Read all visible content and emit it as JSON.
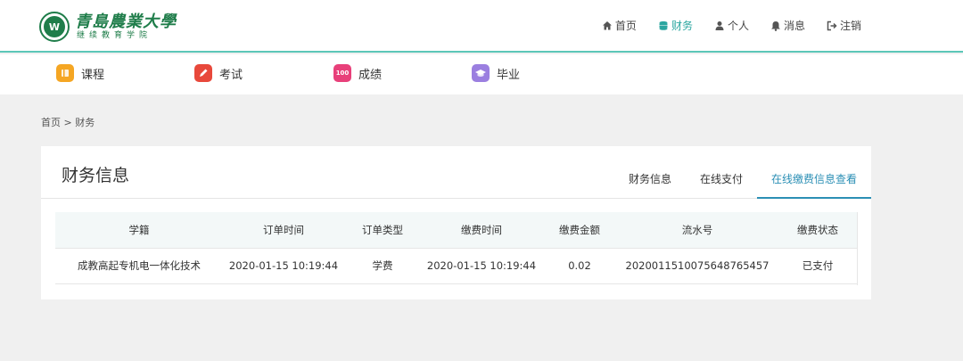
{
  "header": {
    "logo_main": "青島農業大學",
    "logo_sub": "继续教育学院",
    "logo_emblem": "W",
    "nav": [
      {
        "label": "首页",
        "icon": "home-icon"
      },
      {
        "label": "财务",
        "icon": "database-icon"
      },
      {
        "label": "个人",
        "icon": "user-icon"
      },
      {
        "label": "消息",
        "icon": "bell-icon"
      },
      {
        "label": "注销",
        "icon": "logout-icon"
      }
    ]
  },
  "subnav": [
    {
      "label": "课程",
      "icon": "course-icon",
      "color": "#f5a623"
    },
    {
      "label": "考试",
      "icon": "exam-icon",
      "color": "#e8483b"
    },
    {
      "label": "成绩",
      "icon": "score-icon",
      "color": "#e8407a",
      "badge": "100"
    },
    {
      "label": "毕业",
      "icon": "graduation-icon",
      "color": "#9b7fe0"
    }
  ],
  "breadcrumb": {
    "home": "首页",
    "separator": ">",
    "current": "财务"
  },
  "panel": {
    "title": "财务信息",
    "tabs": [
      "财务信息",
      "在线支付",
      "在线缴费信息查看"
    ],
    "active_tab": "在线缴费信息查看"
  },
  "table": {
    "headers": [
      "学籍",
      "订单时间",
      "订单类型",
      "缴费时间",
      "缴费金额",
      "流水号",
      "缴费状态"
    ],
    "rows": [
      [
        "成教高起专机电一体化技术",
        "2020-01-15 10:19:44",
        "学费",
        "2020-01-15 10:19:44",
        "0.02",
        "2020011510075648765457",
        "已支付"
      ]
    ]
  },
  "colors": {
    "accent": "#2ba6a0",
    "tab_active": "#2b8fb5",
    "brand_green": "#1f7d4a"
  }
}
